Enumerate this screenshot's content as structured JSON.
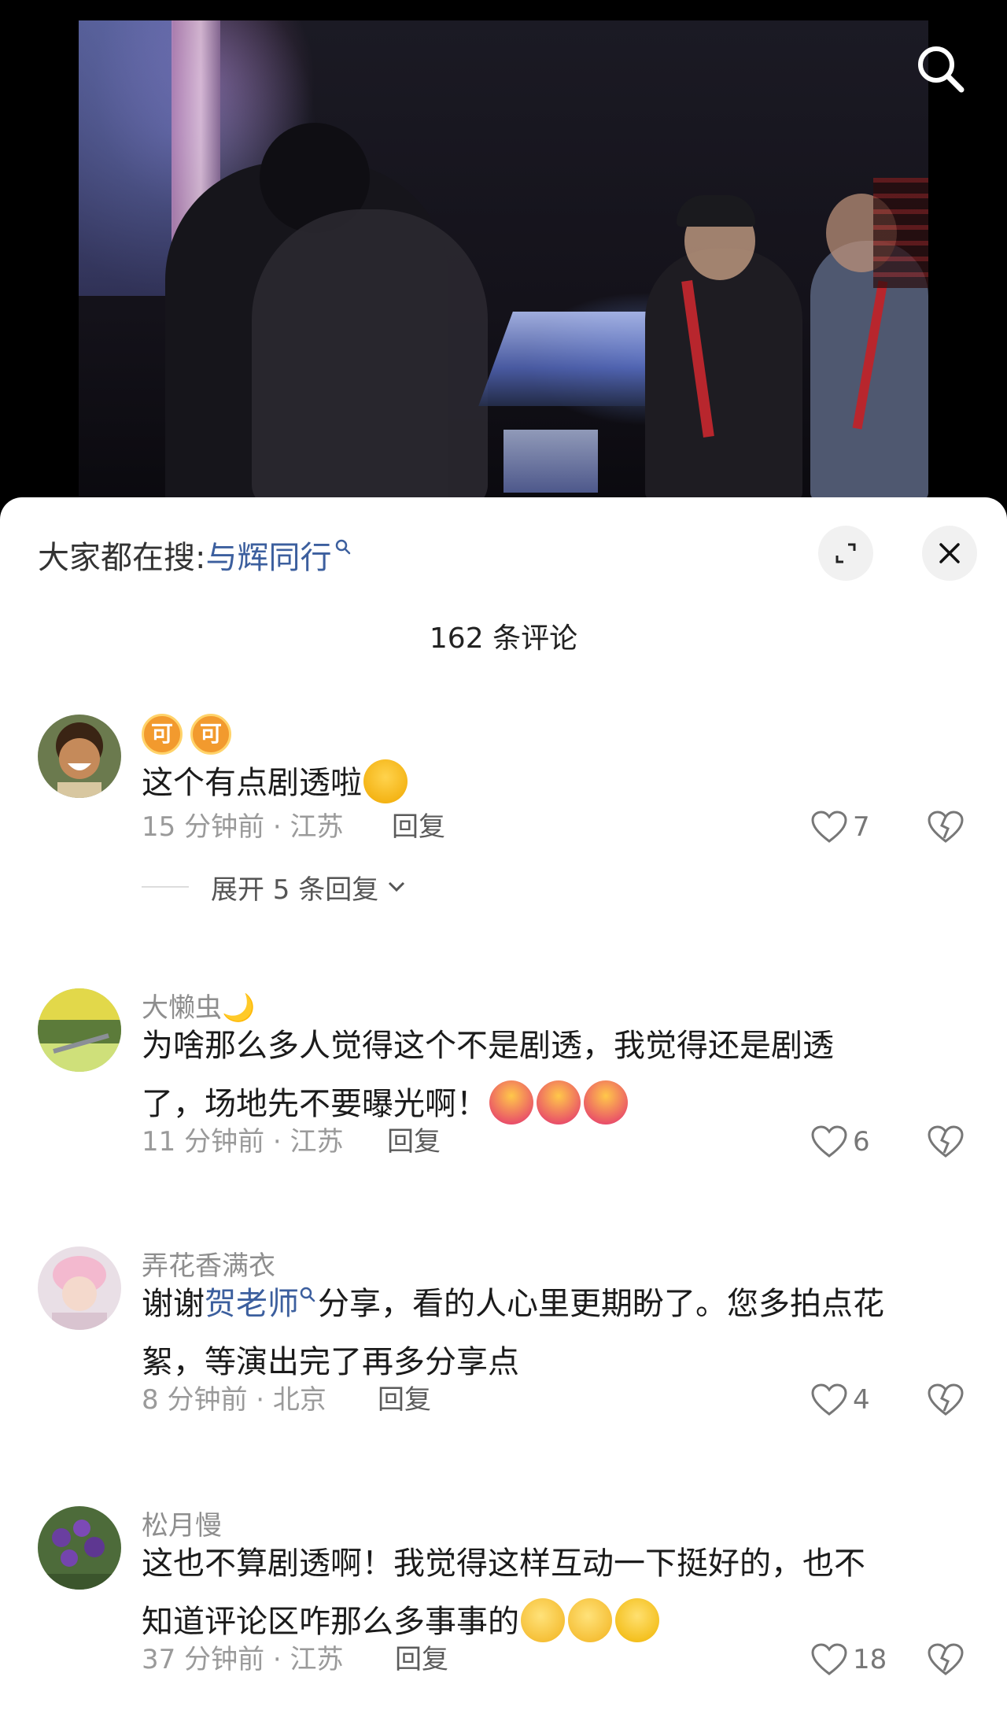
{
  "search_bar": {
    "suggest_prefix": "大家都在搜:",
    "suggest_keyword": "与辉同行"
  },
  "comments_header": {
    "count_label": "162 条评论"
  },
  "comments": [
    {
      "username": "",
      "badges": [
        "可",
        "可"
      ],
      "text": "这个有点剧透啦",
      "emojis": [
        "rofl-emoji"
      ],
      "time_location": "15 分钟前 · 江苏",
      "reply_label": "回复",
      "likes": "7",
      "expand_replies": "展开 5 条回复"
    },
    {
      "username": "大懒虫🌙",
      "text_line1": "为啥那么多人觉得这个不是剧透，我觉得还是剧透",
      "text_line2": "了，场地先不要曝光啊！",
      "emojis": [
        "hugging-emoji",
        "hugging-emoji",
        "hugging-emoji"
      ],
      "time_location": "11 分钟前 · 江苏",
      "reply_label": "回复",
      "likes": "6"
    },
    {
      "username": "弄花香满衣",
      "text_prefix": "谢谢",
      "text_link": "贺老师",
      "text_rest_line1": "分享，看的人心里更期盼了。您多拍点花",
      "text_line2": "絮，等演出完了再多分享点",
      "time_location": "8 分钟前 · 北京",
      "reply_label": "回复",
      "likes": "4"
    },
    {
      "username": "松月慢",
      "text_line1": "这也不算剧透啊！我觉得这样互动一下挺好的，也不",
      "text_line2": "知道评论区咋那么多事事的",
      "emojis": [
        "clapping-emoji",
        "clapping-emoji",
        "smile-emoji"
      ],
      "time_location": "37 分钟前 · 江苏",
      "reply_label": "回复",
      "likes": "18"
    }
  ],
  "colors": {
    "link": "#3c5f9e",
    "meta": "#9a9a9a",
    "badge": "#f29a2e"
  }
}
